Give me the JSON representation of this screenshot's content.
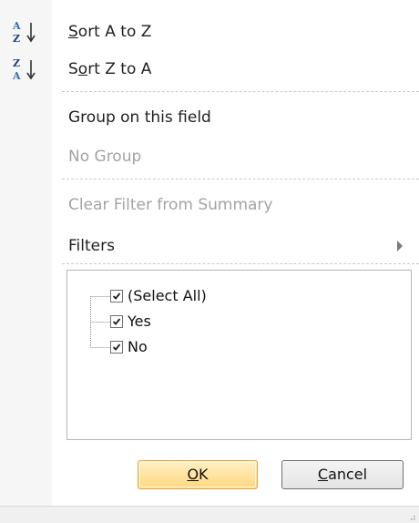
{
  "menu": {
    "sort_az": {
      "prefix": "",
      "accel": "S",
      "rest": "ort A to Z",
      "icon": "sort-ascending-icon"
    },
    "sort_za": {
      "prefix": "S",
      "accel": "o",
      "rest": "rt Z to A",
      "icon": "sort-descending-icon"
    },
    "group_field": "Group on this field",
    "no_group": "No Group",
    "clear_filter": "Clear Filter from Summary",
    "filters": "Filters"
  },
  "filter_list": {
    "items": [
      {
        "label": "(Select All)",
        "checked": true
      },
      {
        "label": "Yes",
        "checked": true
      },
      {
        "label": "No",
        "checked": true
      }
    ]
  },
  "buttons": {
    "ok": {
      "prefix": "",
      "accel": "O",
      "rest": "K"
    },
    "cancel": {
      "prefix": "",
      "accel": "C",
      "rest": "ancel"
    }
  },
  "colors": {
    "accent_button": "#ffd77e",
    "disabled_text": "#a3a3a3"
  }
}
